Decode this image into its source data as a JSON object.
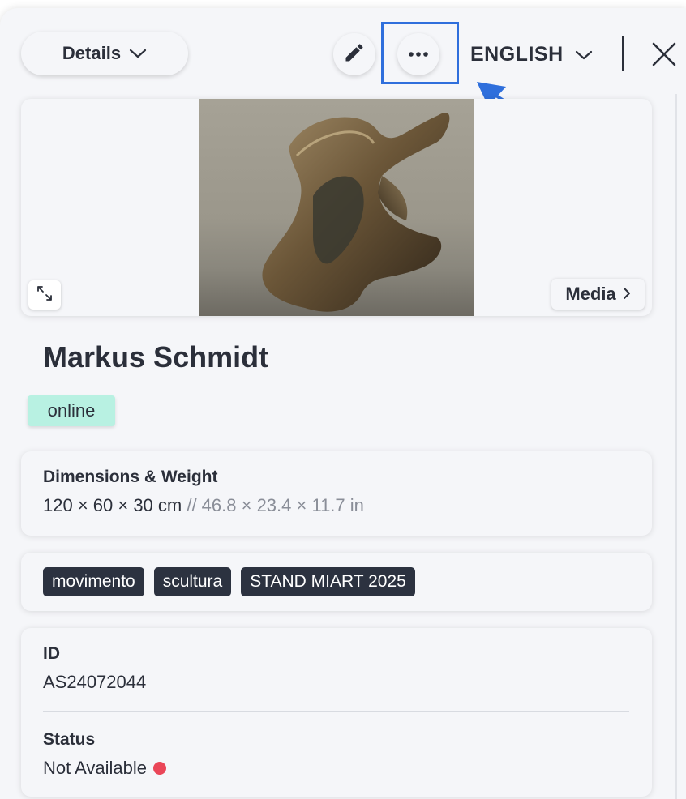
{
  "header": {
    "view_select_label": "Details",
    "language_label": "ENGLISH",
    "icons": [
      "chevron-down-icon",
      "pencil-icon",
      "ellipsis-icon",
      "close-icon"
    ]
  },
  "media": {
    "media_button_label": "Media",
    "image_alt": "Bronze abstract sculpture"
  },
  "artwork": {
    "title": "Markus Schmidt",
    "status_badge": "online"
  },
  "dimensions": {
    "label": "Dimensions & Weight",
    "metric": "120 × 60 × 30 cm",
    "imperial": " // 46.8 × 23.4 × 11.7 in"
  },
  "tags": [
    "movimento",
    "scultura",
    "STAND MIART 2025"
  ],
  "info": {
    "id_label": "ID",
    "id_value": "AS24072044",
    "status_label": "Status",
    "status_value": "Not Available",
    "status_color": "#ea4658"
  },
  "colors": {
    "accent_highlight": "#2f6fdc",
    "badge_online": "#b8f1e2",
    "tag_bg": "#2c3240"
  }
}
